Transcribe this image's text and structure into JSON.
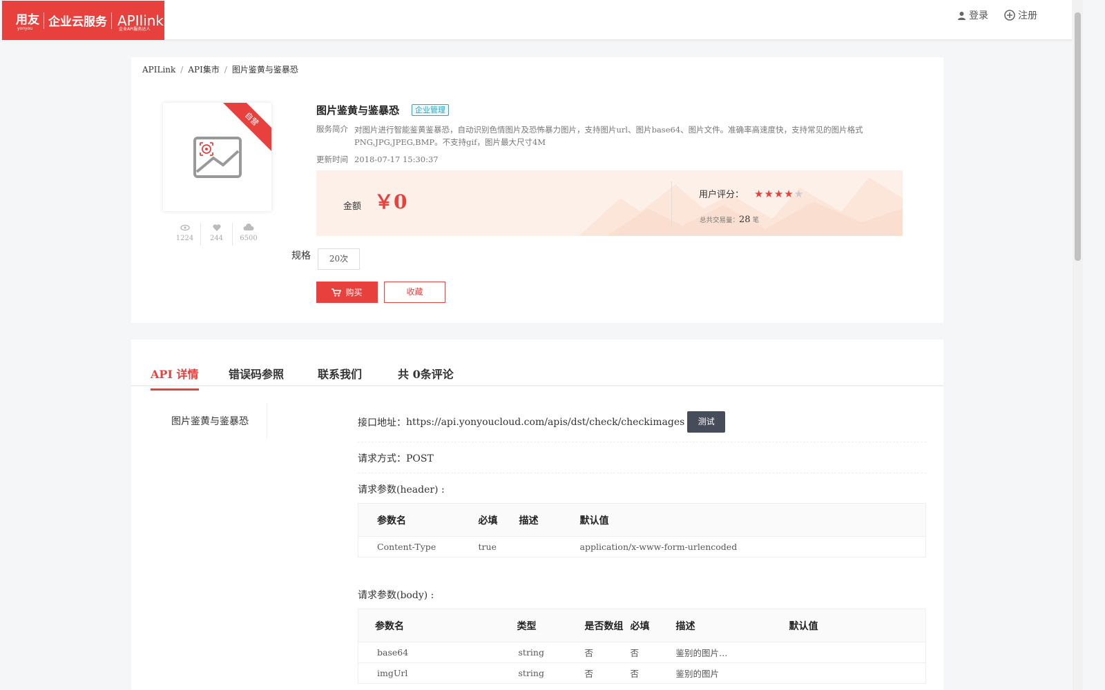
{
  "header": {
    "logo_yonyou": "用友",
    "logo_yonyou_sub": "yonyou",
    "logo_service": "企业云服务",
    "logo_api": "APIlink",
    "logo_api_sub": "企业API服务达人",
    "login_label": "登录",
    "register_label": "注册"
  },
  "breadcrumb": [
    "APILink",
    "API集市",
    "图片鉴黄与鉴暴恐"
  ],
  "product": {
    "ribbon": "自营",
    "stats": [
      {
        "icon": "eye-icon",
        "value": "1224"
      },
      {
        "icon": "heart-icon",
        "value": "244"
      },
      {
        "icon": "cloud-icon",
        "value": "6500"
      }
    ],
    "title": "图片鉴黄与鉴暴恐",
    "tag": "企业管理",
    "intro_label": "服务简介",
    "intro_text": "对图片进行智能鉴黄鉴暴恐，自动识别色情图片及恐怖暴力图片，支持图片url、图片base64、图片文件。准确率高速度快，支持常见的图片格式PNG,JPG,JPEG,BMP。不支持gif，图片最大尺寸4M",
    "updated_label": "更新时间",
    "updated_value": "2018-07-17 15:30:37",
    "amount_label": "金额",
    "amount_value": "￥0",
    "rating_label": "用户评分：",
    "rating_value": 4,
    "rating_max": 5,
    "trade_label": "总共交易量：",
    "trade_count": "28",
    "trade_unit": "笔",
    "spec_label": "规格",
    "spec_option": "20次",
    "buy_label": "购买",
    "fav_label": "收藏"
  },
  "tabs": [
    "API 详情",
    "错误码参照",
    "联系我们",
    "共 0条评论"
  ],
  "detail": {
    "side_item": "图片鉴黄与鉴暴恐",
    "address_label": "接口地址：",
    "address_value": "https://api.yonyoucloud.com/apis/dst/check/checkimages",
    "test_label": "测试",
    "method_label": "请求方式：",
    "method_value": "POST",
    "header_section": "请求参数(header) :",
    "header_table": {
      "columns": [
        "参数名",
        "必填",
        "描述",
        "默认值"
      ],
      "rows": [
        [
          "Content-Type",
          "true",
          "",
          "application/x-www-form-urlencoded"
        ]
      ]
    },
    "body_section": "请求参数(body) :",
    "body_table": {
      "columns": [
        "参数名",
        "类型",
        "是否数组",
        "必填",
        "描述",
        "默认值"
      ],
      "rows": [
        [
          "base64",
          "string",
          "否",
          "否",
          "鉴别的图片…",
          ""
        ],
        [
          "imgUrl",
          "string",
          "否",
          "否",
          "鉴别的图片",
          ""
        ]
      ]
    }
  },
  "colors": {
    "accent": "#e8413d",
    "tag": "#1ea8c8",
    "test_button": "#474c5b",
    "price_bg": "#fdf0e9"
  }
}
